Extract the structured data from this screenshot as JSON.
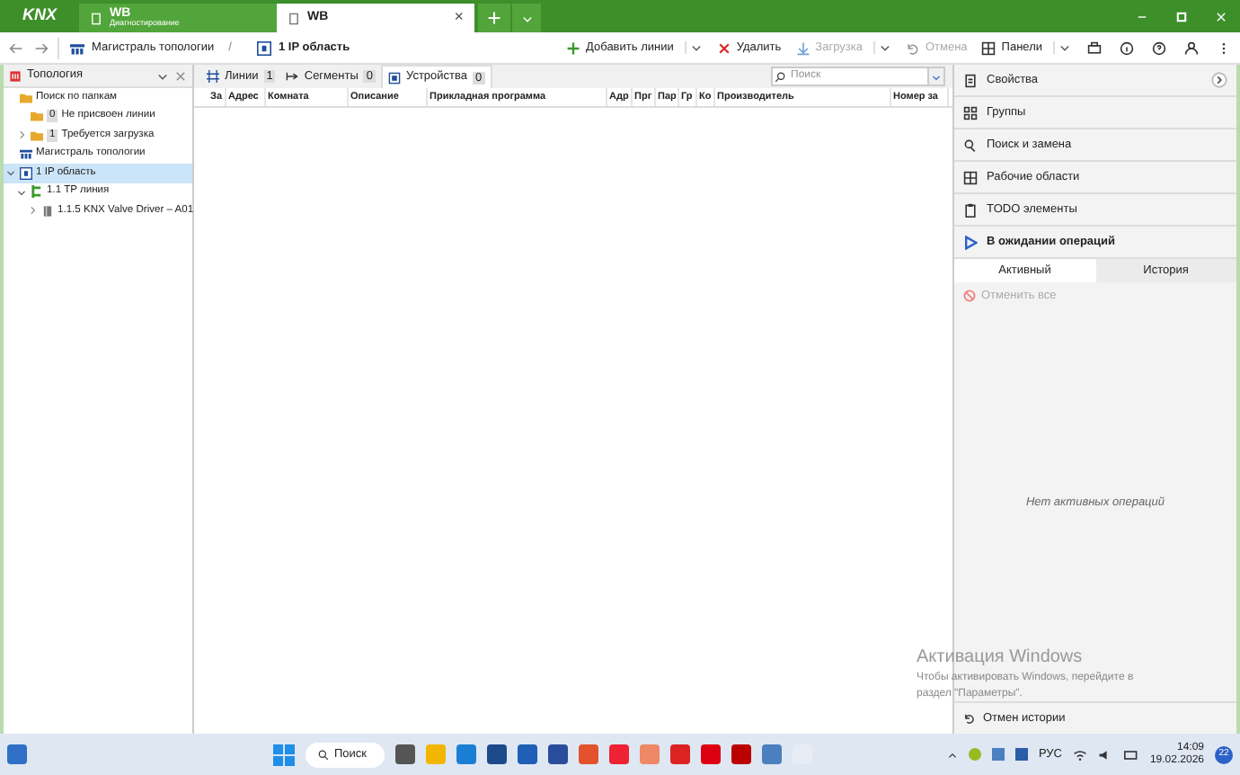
{
  "app_logo": "KNX",
  "title_tabs": [
    {
      "title": "WB",
      "subtitle": "Диагностирование",
      "selected": false
    },
    {
      "title": "WB",
      "close": "×",
      "selected": true
    }
  ],
  "breadcrumb": [
    {
      "label": "Магистраль топологии",
      "kind": "backbone"
    },
    {
      "label": "1 IP область",
      "kind": "area"
    }
  ],
  "breadcrumb_separator": "/",
  "toolbar": [
    {
      "label": "Добавить линии",
      "kind": "add",
      "disabled": false,
      "menu": true
    },
    {
      "label": "Удалить",
      "kind": "delete",
      "disabled": false,
      "menu": false
    },
    {
      "label": "Загрузка",
      "kind": "download",
      "disabled": true,
      "menu": true
    },
    {
      "label": "Отмена",
      "kind": "undo",
      "disabled": true,
      "menu": false
    },
    {
      "label": "Панели",
      "kind": "panels",
      "disabled": false,
      "menu": true
    }
  ],
  "sidebar": {
    "title": "Топология",
    "tree": [
      {
        "label": "Поиск по папкам",
        "kind": "folder",
        "selected": false,
        "children": [
          {
            "label": "Не присвоен линии",
            "kind": "folder",
            "count": "0",
            "selected": false
          },
          {
            "label": "Требуется загрузка",
            "kind": "folder",
            "count": "1",
            "expanded": false,
            "selected": false
          }
        ]
      },
      {
        "label": "Магистраль топологии",
        "kind": "backbone",
        "selected": false
      },
      {
        "label": "1 IP область",
        "kind": "area",
        "expanded": true,
        "selected": true,
        "children": [
          {
            "label": "1.1 TP линия",
            "kind": "line",
            "expanded": true,
            "selected": false,
            "children": [
              {
                "label": "1.1.5 KNX Valve Driver – A01",
                "kind": "device",
                "expanded": false,
                "selected": false
              }
            ]
          }
        ]
      }
    ]
  },
  "view_tabs": [
    {
      "label": "Линии",
      "count": "1",
      "kind": "lines",
      "selected": false
    },
    {
      "label": "Сегменты",
      "count": "0",
      "kind": "segments",
      "selected": false
    },
    {
      "label": "Устройства",
      "count": "0",
      "kind": "devices",
      "selected": true
    }
  ],
  "search": {
    "placeholder": "Поиск"
  },
  "table": {
    "columns": [
      "За",
      "Адрес",
      "Комната",
      "Описание",
      "Прикладная программа",
      "Адр",
      "Прг",
      "Пар",
      "Гр",
      "Ко",
      "Производитель",
      "Номер за"
    ]
  },
  "windows_notice": {
    "title": "Активация Windows",
    "text": "Чтобы активировать Windows, перейдите в раздел \"Параметры\"."
  },
  "panels": [
    {
      "label": "Свойства",
      "kind": "properties",
      "bold": false,
      "expand": true
    },
    {
      "label": "Группы",
      "kind": "groups",
      "bold": false,
      "expand": false
    },
    {
      "label": "Поиск и замена",
      "kind": "replace",
      "bold": false,
      "expand": false
    },
    {
      "label": "Рабочие области",
      "kind": "workspaces",
      "bold": false,
      "expand": false
    },
    {
      "label": "TODO элементы",
      "kind": "todo",
      "bold": false,
      "expand": false
    },
    {
      "label": "В ожидании операций",
      "kind": "pending",
      "bold": true,
      "expand": false
    }
  ],
  "operation_tabs": [
    {
      "label": "Активный",
      "selected": true
    },
    {
      "label": "История",
      "selected": false
    }
  ],
  "cancel_all": {
    "label": "Отменить все",
    "disabled": true
  },
  "empty_message": "Нет активных операций",
  "history_button": "Отмен истории",
  "taskbar": {
    "search": "Поиск",
    "language": "РУС",
    "time": "14:09",
    "date": "19.02.2026",
    "notifications": "22"
  }
}
